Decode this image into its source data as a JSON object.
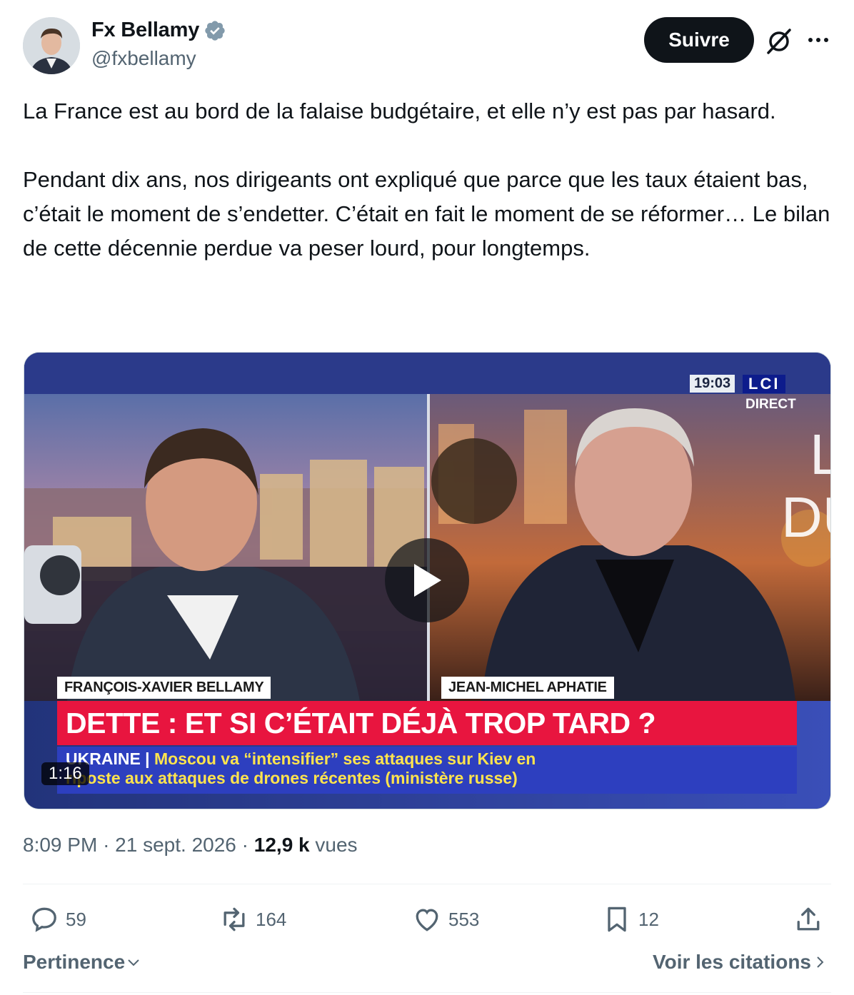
{
  "author": {
    "name": "Fx Bellamy",
    "handle": "@fxbellamy",
    "verified": true
  },
  "header": {
    "follow_label": "Suivre",
    "grok_icon": "grok-icon",
    "more_icon": "more-icon"
  },
  "tweet": {
    "text": "La France est au bord de la falaise budgétaire, et elle n’y est pas par hasard.\n\nPendant dix ans, nos dirigeants ont expliqué que parce que les taux étaient bas, c’était le moment de s’endetter. C’était en fait le moment de se réformer… Le bilan de cette décennie perdue va peser lourd, pour longtemps."
  },
  "video": {
    "clock": "19:03",
    "channel": "LCI",
    "live": "DIRECT",
    "name_left": "FRANÇOIS-XAVIER BELLAMY",
    "name_right": "JEAN-MICHEL APHATIE",
    "headline": "DETTE : ET SI C’ÉTAIT DÉJÀ TROP TARD ?",
    "ticker_keyword": "UKRAINE |",
    "ticker_line1": "Moscou va “intensifier” ses attaques sur Kiev en",
    "ticker_line2": "riposte aux attaques de drones récentes (ministère russe)",
    "duration": "1:16",
    "bg_letters_1": "L",
    "bg_letters_2": "DU"
  },
  "meta": {
    "time": "8:09 PM",
    "sep": "·",
    "date": "21 sept. 2026",
    "views_count": "12,9 k",
    "views_label": "vues"
  },
  "actions": {
    "replies": "59",
    "reposts": "164",
    "likes": "553",
    "bookmarks": "12"
  },
  "footer": {
    "sort_label": "Pertinence",
    "quotes_label": "Voir les citations"
  },
  "colors": {
    "accent": "#0f1419",
    "muted": "#536471",
    "headline_red": "#e8153f",
    "ticker_blue": "#2d3fbf",
    "verified_blue": "#829aab"
  }
}
